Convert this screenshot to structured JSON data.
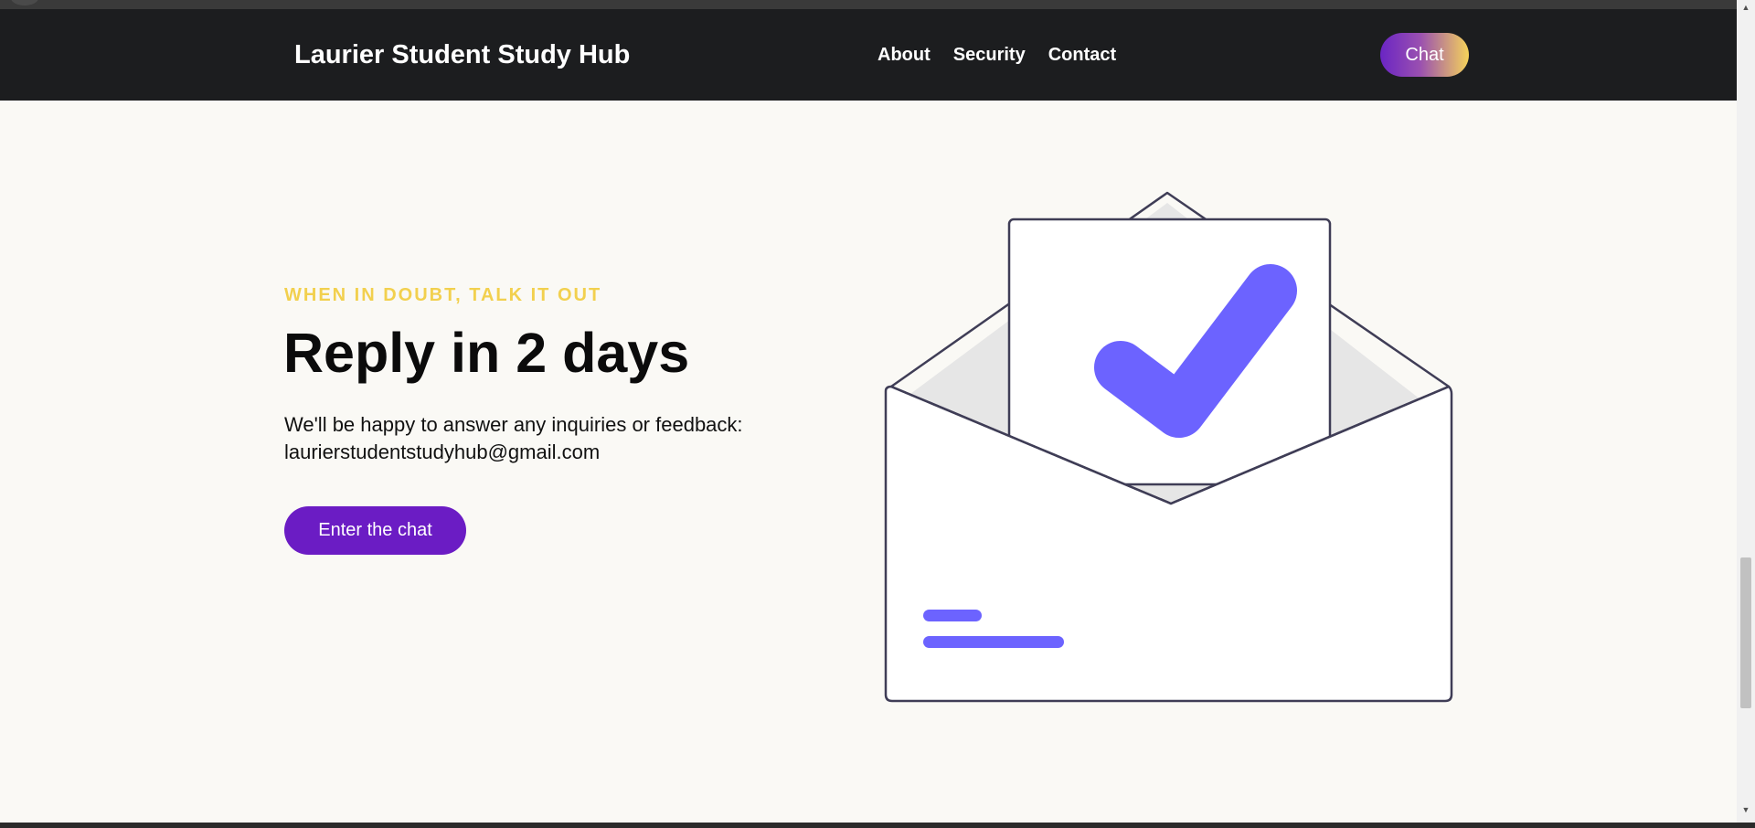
{
  "navbar": {
    "brand": "Laurier Student Study Hub",
    "links": [
      {
        "label": "About"
      },
      {
        "label": "Security"
      },
      {
        "label": "Contact"
      }
    ],
    "chat_button": "Chat"
  },
  "hero": {
    "eyebrow": "WHEN IN DOUBT, TALK IT OUT",
    "headline": "Reply in 2 days",
    "description_line1": "We'll be happy to answer any inquiries or feedback:",
    "email": "laurierstudentstudyhub@gmail.com",
    "cta_label": "Enter the chat"
  },
  "illustration": {
    "icon": "envelope-checkmark-icon",
    "accent_color": "#6c63ff"
  },
  "colors": {
    "navbar_bg": "#1c1d1f",
    "page_bg": "#faf9f5",
    "eyebrow": "#f2d04e",
    "cta_bg": "#6b1cc4",
    "chat_gradient_start": "#6a25c4",
    "chat_gradient_end": "#f5d35a"
  }
}
